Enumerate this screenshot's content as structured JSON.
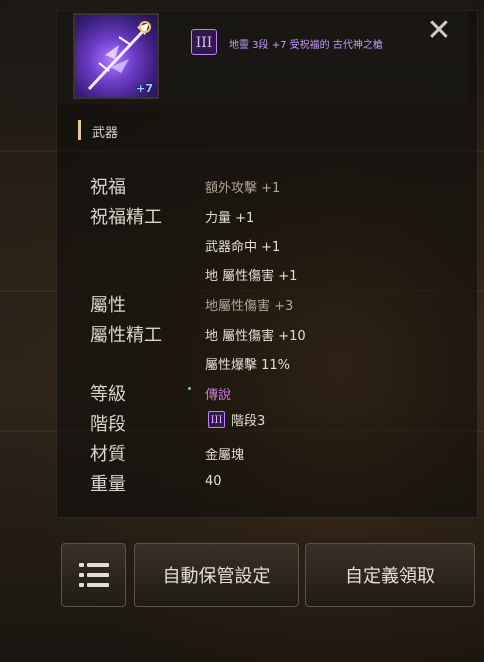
{
  "header": {
    "item_enhance": "+7",
    "tier_badge": "III",
    "item_name": "地靈 3段 +7 受祝福的 古代神之槍",
    "close_label": "✕"
  },
  "item_type": "武器",
  "stats": [
    {
      "label": "祝福",
      "value": "額外攻擊 +1"
    },
    {
      "label": "祝福精工",
      "value": "力量 +1"
    },
    {
      "label": "",
      "value": "武器命中 +1"
    },
    {
      "label": "",
      "value": "地 屬性傷害 +1"
    },
    {
      "label": "屬性",
      "value": "地屬性傷害 +3"
    },
    {
      "label": "屬性精工",
      "value": "地 屬性傷害 +10"
    },
    {
      "label": "",
      "value": "屬性爆擊 11%"
    },
    {
      "label": "等級",
      "value": "傳說"
    },
    {
      "label": "階段",
      "value": "階段3",
      "badge": "III"
    },
    {
      "label": "材質",
      "value": "金屬塊"
    },
    {
      "label": "重量",
      "value": "40"
    }
  ],
  "buttons": {
    "auto_storage": "自動保管設定",
    "custom_claim": "自定義領取"
  },
  "icons": {
    "menu": "list-menu-icon",
    "close": "close-icon",
    "item": "spear-weapon-icon"
  },
  "colors": {
    "tier_purple": "#c67dff",
    "legend_pink": "#d07ad6",
    "accent_gold": "#e8c99a"
  }
}
